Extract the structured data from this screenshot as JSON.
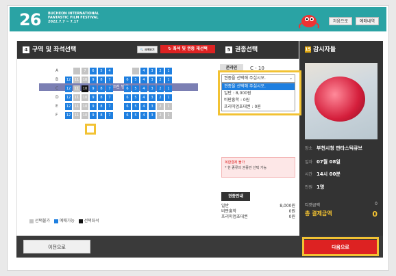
{
  "header": {
    "number": "26",
    "festival_lines": [
      "BUCHEON INTERNATIONAL",
      "FANTASTIC FILM FESTIVAL",
      "2022.7.7 ~ 7.17"
    ],
    "btn_home": "처음으로",
    "btn_reservations": "예매내역"
  },
  "seat_panel": {
    "step": "4",
    "title": "구역 및 좌석선택",
    "zoom_label": "크게보기",
    "reset_label": "좌석 및 권종 재선택",
    "screen_label": "스크린 방향",
    "rows": [
      {
        "label": "A",
        "left": [
          "",
          "7",
          "6",
          "5",
          "4"
        ],
        "right": [
          "",
          "4",
          "3",
          "2",
          "1"
        ]
      },
      {
        "label": "B",
        "left": [
          "12",
          "11",
          "10",
          "9",
          "8",
          "7"
        ],
        "right": [
          "6",
          "5",
          "4",
          "3",
          "2",
          "1"
        ]
      },
      {
        "label": "C",
        "left": [
          "12",
          "11",
          "10",
          "9",
          "8",
          "7"
        ],
        "right": [
          "6",
          "5",
          "4",
          "3",
          "2",
          "1"
        ]
      },
      {
        "label": "D",
        "left": [
          "12",
          "11",
          "10",
          "9",
          "8",
          "7"
        ],
        "right": [
          "6",
          "5",
          "4",
          "3",
          "2",
          "1"
        ]
      },
      {
        "label": "E",
        "left": [
          "12",
          "11",
          "10",
          "9",
          "8",
          "7"
        ],
        "right": [
          "6",
          "5",
          "4",
          "3",
          "2",
          "1"
        ]
      },
      {
        "label": "F",
        "left": [
          "12",
          "11",
          "10",
          "9",
          "8",
          "7"
        ],
        "right": [
          "6",
          "5",
          "4",
          "3",
          "2",
          "1"
        ]
      }
    ],
    "legend": {
      "unavailable": "선택불가",
      "available": "예매가능",
      "selected": "선택좌석"
    }
  },
  "ticket_panel": {
    "step": "5",
    "title": "권종선택",
    "tab_label": "온라인",
    "seat_code": "C - 10",
    "dropdown_value": "권종을 선택해 주십시오.",
    "options": [
      "권종을 선택해 주십시오.",
      "일반 : 8,000원",
      "비판흥학 : 0원",
      "프리미엄초대권 : 0원"
    ],
    "notice_title": "복합결제 불가",
    "notice_body": "* 한 종류의 권종만 선택 가능",
    "guide_title": "권종안내",
    "guide_rows": [
      {
        "name": "일반",
        "price": "8,000원"
      },
      {
        "name": "비판흥학",
        "price": "0원"
      },
      {
        "name": "프리미엄초대권",
        "price": "0원"
      }
    ]
  },
  "movie_panel": {
    "age": "15",
    "title": "감시자들",
    "place_key": "장소",
    "place_val": "부천시청 판타스틱큐브",
    "date_key": "일자",
    "date_val": "07월 08일",
    "time_key": "시간",
    "time_val": "14시 00분",
    "people_key": "인원",
    "people_val": "1명",
    "ticket_label": "티켓금액",
    "ticket_val": "0",
    "total_label": "총 결제금액",
    "total_val": "0"
  },
  "footer": {
    "prev": "이전으로",
    "next": "다음으로"
  },
  "colors": {
    "teal": "#2aa3a4",
    "seat_available": "#1e7fe0",
    "seat_unavailable": "#c4c4c4",
    "highlight": "#f2c233",
    "red": "#dd2222"
  }
}
